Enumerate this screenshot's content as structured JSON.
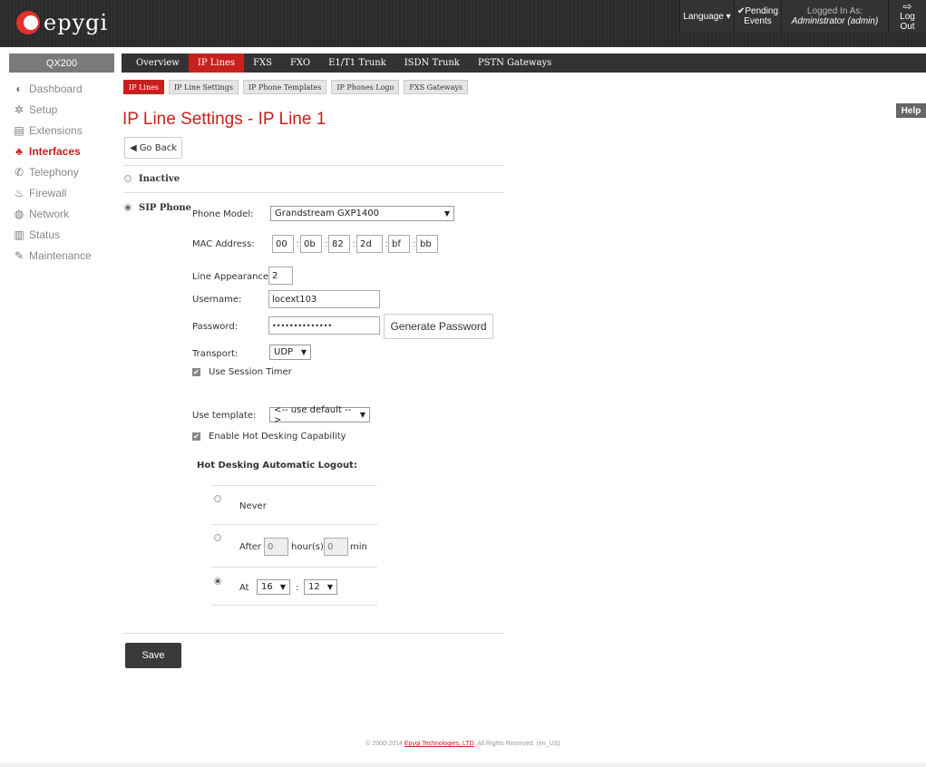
{
  "brand": {
    "name": "epygi"
  },
  "topbar": {
    "language": "Language",
    "pending_line1": "Pending",
    "pending_line2": "Events",
    "logged_in_label": "Logged In As:",
    "logged_in_user": "Administrator (admin)",
    "logout": "Log Out"
  },
  "device": "QX200",
  "sidebar": {
    "items": [
      {
        "label": "Dashboard",
        "icon": "dashboard-icon"
      },
      {
        "label": "Setup",
        "icon": "gear-icon"
      },
      {
        "label": "Extensions",
        "icon": "book-icon"
      },
      {
        "label": "Interfaces",
        "icon": "network-icon"
      },
      {
        "label": "Telephony",
        "icon": "phone-icon"
      },
      {
        "label": "Firewall",
        "icon": "fire-icon"
      },
      {
        "label": "Network",
        "icon": "globe-icon"
      },
      {
        "label": "Status",
        "icon": "bar-chart-icon"
      },
      {
        "label": "Maintenance",
        "icon": "wrench-icon"
      }
    ]
  },
  "main_tabs": [
    "Overview",
    "IP Lines",
    "FXS",
    "FXO",
    "E1/T1 Trunk",
    "ISDN Trunk",
    "PSTN Gateways"
  ],
  "sub_tabs": [
    "IP Lines",
    "IP Line Settings",
    "IP Phone Templates",
    "IP Phones Logo",
    "FXS Gateways"
  ],
  "help": "Help",
  "page_title": "IP Line Settings - IP Line 1",
  "go_back": "Go Back",
  "form": {
    "inactive_label": "Inactive",
    "sip_phone_label": "SIP Phone",
    "phone_model_label": "Phone Model:",
    "phone_model_value": "Grandstream GXP1400",
    "mac_label": "MAC Address:",
    "mac": [
      "00",
      "0b",
      "82",
      "2d",
      "bf",
      "bb"
    ],
    "line_appearance_label": "Line Appearance:",
    "line_appearance_value": "2",
    "username_label": "Username:",
    "username_value": "locext103",
    "password_label": "Password:",
    "password_value": "••••••••••••••",
    "generate_password": "Generate Password",
    "transport_label": "Transport:",
    "transport_value": "UDP",
    "use_session_timer": "Use Session Timer",
    "use_template_label": "Use template:",
    "use_template_value": "<-- use default -->",
    "enable_hot_desking": "Enable Hot Desking Capability",
    "hot_desking_title": "Hot Desking Automatic Logout:",
    "never": "Never",
    "after": "After",
    "after_hours": "0",
    "hours_unit": "hour(s)",
    "after_min": "0",
    "min_unit": "min",
    "at": "At",
    "at_hour": "16",
    "at_minute": "12",
    "time_sep": ":"
  },
  "save": "Save",
  "footer": {
    "pre": "© 2000-2014 ",
    "link": "Epygi Technologies, LTD",
    "post": ". All Rights Reserved. (en_US)"
  }
}
